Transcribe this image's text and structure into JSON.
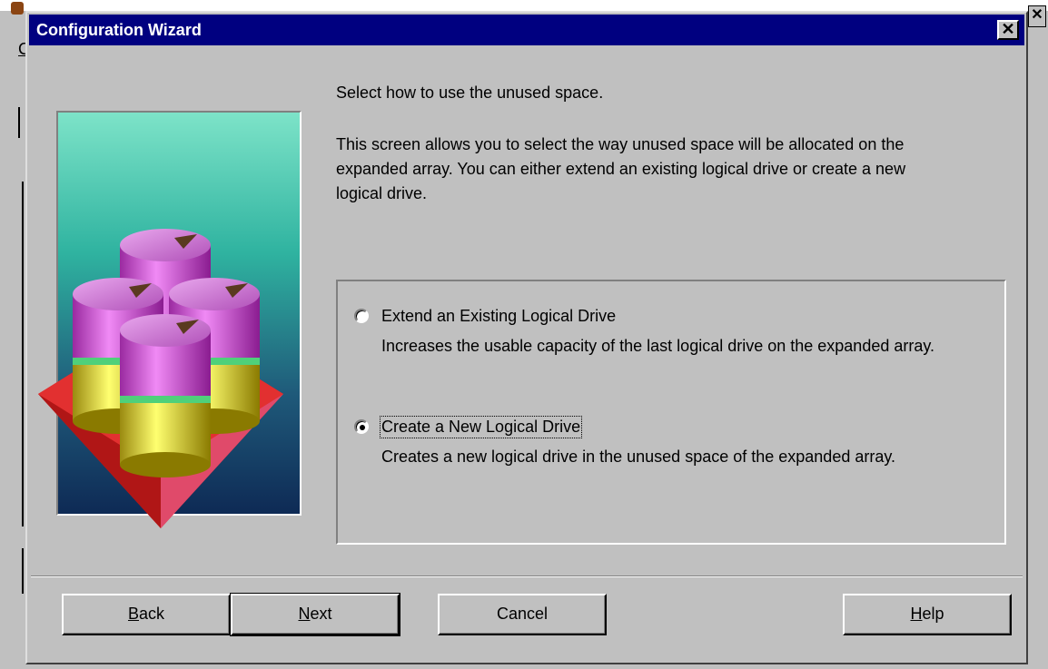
{
  "dialog": {
    "title": "Configuration Wizard",
    "close_glyph": "✕"
  },
  "background_app": {
    "menu_letter": "C"
  },
  "page": {
    "heading": "Select how to use the unused space.",
    "description": "This screen allows you to select the way unused space will be allocated on the expanded array. You can either extend an existing logical drive or create a new logical drive."
  },
  "options": [
    {
      "label": "Extend an Existing Logical Drive",
      "description": "Increases the usable capacity of the last logical drive on the expanded array.",
      "selected": false
    },
    {
      "label": "Create a New Logical Drive",
      "description": "Creates a new logical drive in the unused space of the expanded array.",
      "selected": true
    }
  ],
  "buttons": {
    "back": {
      "mnemonic": "B",
      "rest": "ack"
    },
    "next": {
      "mnemonic": "N",
      "rest": "ext"
    },
    "cancel": "Cancel",
    "help": {
      "mnemonic": "H",
      "rest": "elp"
    }
  },
  "icons": {
    "art": "disk-array-illustration-icon",
    "close": "close-icon"
  },
  "colors": {
    "titlebar": "#000080",
    "face": "#c0c0c0"
  }
}
